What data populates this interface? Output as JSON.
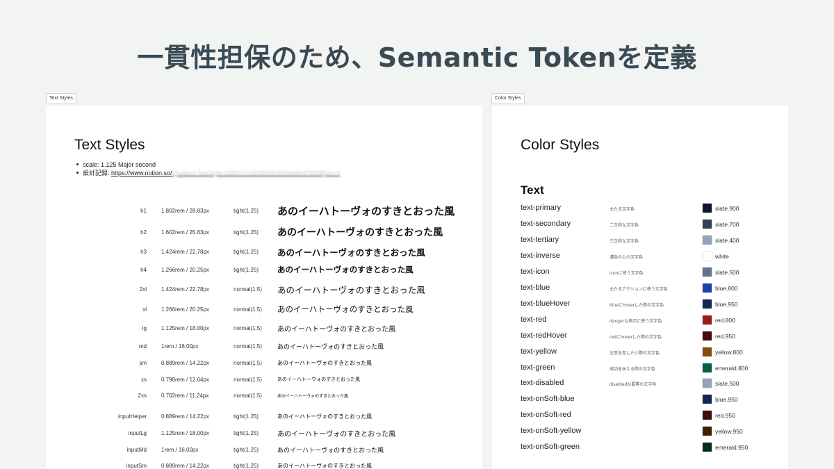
{
  "slide_title": "一貫性担保のため、Semantic Tokenを定義",
  "text_frame": {
    "tag": "Text Styles",
    "heading": "Text Styles",
    "notes": {
      "scale": "scale: 1.125 Major second",
      "record_label": "設計記録: ",
      "record_link": "https://www.notion.so/",
      "record_link_blurred": "Qiuaitv3-TextStyle-1583747cbf1804fb950e6dfbd7f839fpvs=4"
    },
    "rows": [
      {
        "name": "h1",
        "size": "1.802rem / 28.83px",
        "lh": "tight(1.25)",
        "sample": "あのイーハトーヴォのすきとおった風"
      },
      {
        "name": "h2",
        "size": "1.602rem / 25.63px",
        "lh": "tight(1.25)",
        "sample": "あのイーハトーヴォのすきとおった風"
      },
      {
        "name": "h3",
        "size": "1.424rem / 22.78px",
        "lh": "tight(1.25)",
        "sample": "あのイーハトーヴォのすきとおった風"
      },
      {
        "name": "h4",
        "size": "1.266rem / 20.25px",
        "lh": "tight(1.25)",
        "sample": "あのイーハトーヴォのすきとおった風"
      },
      {
        "name": "2xl",
        "size": "1.424rem / 22.78px",
        "lh": "normal(1.5)",
        "sample": "あのイーハトーヴォのすきとおった風"
      },
      {
        "name": "xl",
        "size": "1.266rem / 20.25px",
        "lh": "normal(1.5)",
        "sample": "あのイーハトーヴォのすきとおった風"
      },
      {
        "name": "lg",
        "size": "1.125rem / 18.00px",
        "lh": "normal(1.5)",
        "sample": "あのイーハトーヴォのすきとおった風"
      },
      {
        "name": "md",
        "size": "1rem / 16.00px",
        "lh": "normal(1.5)",
        "sample": "あのイーハトーヴォのすきとおった風"
      },
      {
        "name": "sm",
        "size": "0.889rem / 14.22px",
        "lh": "normal(1.5)",
        "sample": "あのイーハトーヴォのすきとおった風"
      },
      {
        "name": "xs",
        "size": "0.790rem / 12.64px",
        "lh": "normal(1.5)",
        "sample": "あのイーハトーヴォのすきとおった風"
      },
      {
        "name": "2xs",
        "size": "0.702rem / 11.24px",
        "lh": "normal(1.5)",
        "sample": "あのイーハトーヴォのすきとおった風"
      },
      {
        "name": "inputHelper",
        "size": "0.889rem / 14.22px",
        "lh": "tight(1.25)",
        "sample": "あのイーハトーヴォのすきとおった風"
      },
      {
        "name": "inputLg",
        "size": "1.125rem / 18.00px",
        "lh": "tight(1.25)",
        "sample": "あのイーハトーヴォのすきとおった風"
      },
      {
        "name": "inputMd",
        "size": "1rem / 16.00px",
        "lh": "tight(1.25)",
        "sample": "あのイーハトーヴォのすきとおった風"
      },
      {
        "name": "inputSm",
        "size": "0.889rem / 14.22px",
        "lh": "tight(1.25)",
        "sample": "あのイーハトーヴォのすきとおった風"
      }
    ]
  },
  "color_frame": {
    "tag": "Color Styles",
    "heading": "Color Styles",
    "section": "Text",
    "rows": [
      {
        "name": "text-primary",
        "desc": "主たる文字色",
        "token": "slate.900",
        "color": "#0f172a"
      },
      {
        "name": "text-secondary",
        "desc": "二次的な文字色",
        "token": "slate.700",
        "color": "#334155"
      },
      {
        "name": "text-tertiary",
        "desc": "三次的な文字色",
        "token": "slate.400",
        "color": "#94a3b8"
      },
      {
        "name": "text-inverse",
        "desc": "濃色の上の文字色",
        "token": "white",
        "color": "#ffffff"
      },
      {
        "name": "text-icon",
        "desc": "iconに使う文字色",
        "token": "slate.500",
        "color": "#64748b"
      },
      {
        "name": "text-blue",
        "desc": "主たるアクションに使う文字色",
        "token": "blue.800",
        "color": "#1e40af"
      },
      {
        "name": "text-blueHover",
        "desc": "blueにhoverした際の文字色",
        "token": "blue.950",
        "color": "#172554"
      },
      {
        "name": "text-red",
        "desc": "dangerな表示に使う文字色",
        "token": "red.800",
        "color": "#991b1b"
      },
      {
        "name": "text-redHover",
        "desc": "redにhoverした際の文字色",
        "token": "red.950",
        "color": "#450a0a"
      },
      {
        "name": "text-yellow",
        "desc": "注意を促したい際の文字色",
        "token": "yellow.800",
        "color": "#854d0e"
      },
      {
        "name": "text-green",
        "desc": "成功を伝える際の文字色",
        "token": "emerald.800",
        "color": "#065f46"
      },
      {
        "name": "text-disabled",
        "desc": "disabledな要素の文字色",
        "token": "slate.500",
        "color": "#94a3b8"
      },
      {
        "name": "text-onSoft-blue",
        "desc": "",
        "token": "blue.950",
        "color": "#172554"
      },
      {
        "name": "text-onSoft-red",
        "desc": "",
        "token": "red.950",
        "color": "#450a0a"
      },
      {
        "name": "text-onSoft-yellow",
        "desc": "",
        "token": "yellow.950",
        "color": "#422006"
      },
      {
        "name": "text-onSoft-green",
        "desc": "",
        "token": "emerald.950",
        "color": "#022c22"
      }
    ]
  }
}
